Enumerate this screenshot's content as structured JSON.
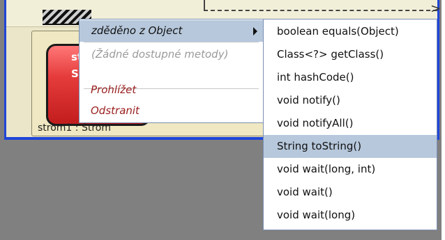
{
  "object": {
    "button_line1": "str",
    "button_line2": "St",
    "instance_label": "strom1 : Strom"
  },
  "context_menu": {
    "items": [
      {
        "label": "zděděno z Object",
        "has_submenu": true,
        "state": "selected"
      },
      {
        "label": "(Žádné dostupné metody)",
        "state": "disabled"
      },
      {
        "label": "Prohlížet",
        "state": "danger"
      },
      {
        "label": "Odstranit",
        "state": "danger"
      }
    ]
  },
  "submenu": {
    "items": [
      {
        "label": "boolean equals(Object)"
      },
      {
        "label": "Class<?> getClass()"
      },
      {
        "label": "int hashCode()"
      },
      {
        "label": "void notify()"
      },
      {
        "label": "void notifyAll()"
      },
      {
        "label": "String toString()",
        "selected": true
      },
      {
        "label": "void wait(long, int)"
      },
      {
        "label": "void wait()"
      },
      {
        "label": "void wait(long)"
      }
    ]
  },
  "colors": {
    "window_border": "#1f45d8",
    "selection": "#b7c8dc",
    "danger_text": "#9a1d1d",
    "disabled_text": "#9a9a9a"
  }
}
